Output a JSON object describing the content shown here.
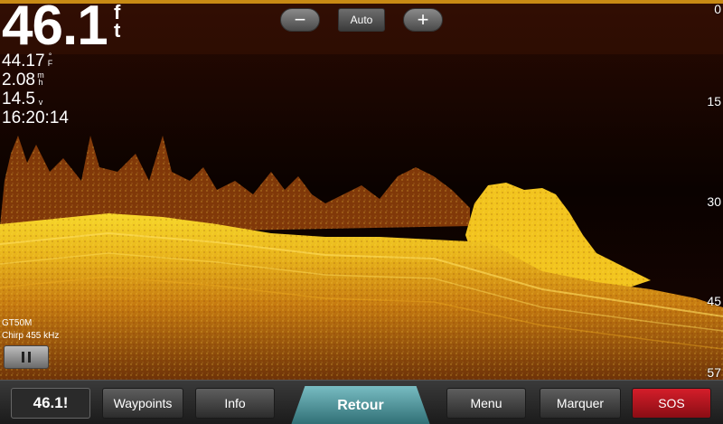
{
  "readouts": {
    "depth_value": "46.1",
    "depth_unit": "ft",
    "water_temp": "44.17",
    "water_temp_unit": "°F",
    "speed": "2.08",
    "speed_unit": "mh",
    "voltage": "14.5",
    "voltage_unit": "v",
    "time": "16:20:14"
  },
  "zoom": {
    "minus_label": "−",
    "mode_label": "Auto",
    "plus_label": "+"
  },
  "depth_scale": [
    "0",
    "15",
    "30",
    "45",
    "57"
  ],
  "transducer": {
    "model": "GT50M",
    "frequency": "Chirp 455 kHz"
  },
  "pause_icon": "pause-icon",
  "toolbar": {
    "depth_label": "46.1!",
    "waypoints_label": "Waypoints",
    "info_label": "Info",
    "retour_label": "Retour",
    "menu_label": "Menu",
    "marquer_label": "Marquer",
    "sos_label": "SOS"
  },
  "colors": {
    "sonar_strong": "#f5d21a",
    "sonar_mid": "#d98a12",
    "sonar_weak": "#7a2a06",
    "sos_red": "#c8141e",
    "retour_teal": "#4f9ba1"
  }
}
